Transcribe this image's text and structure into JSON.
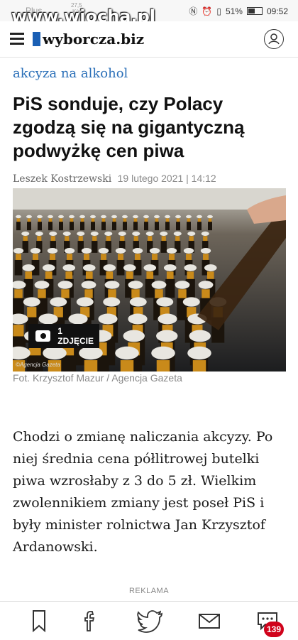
{
  "status_bar": {
    "carrier": "Plus",
    "net_speed": "27,5",
    "net_unit": "K/s",
    "battery": "51%",
    "battery_level": 0.51,
    "time": "09:52"
  },
  "watermark": "www.wiocha.pl",
  "header": {
    "logo_text": "wyborcza.biz",
    "menu_icon": "hamburger-icon",
    "user_icon": "user-icon"
  },
  "article": {
    "kicker": "akcyza na alkohol",
    "headline": "PiS sonduje, czy Polacy zgodzą się na gigantyczną podwyżkę cen piwa",
    "author": "Leszek Kostrzewski",
    "date": "19 lutego 2021 | 14:12",
    "photo_badge": "1 ZDJĘCIE",
    "photo_watermark": "©Agencja Gazeta",
    "photo_caption": "Fot. Krzysztof Mazur / Agencja Gazeta",
    "lead": "Chodzi o zmianę naliczania akcyzy. Po niej średnia cena półlitrowej butelki piwa wzrosłaby z 3 do 5 zł. Wielkim zwolennikiem zmiany jest poseł PiS i były minister rolnictwa Jan Krzysztof Ardanowski."
  },
  "ad_label": "REKLAMA",
  "share_bar": {
    "items": [
      "bookmark-icon",
      "facebook-icon",
      "twitter-icon",
      "mail-icon",
      "comments-icon"
    ],
    "comment_count": "139",
    "badge_color": "#d0021b"
  },
  "colors": {
    "kicker": "#2a6fb8",
    "logo_accent": "#1a5fb4"
  }
}
